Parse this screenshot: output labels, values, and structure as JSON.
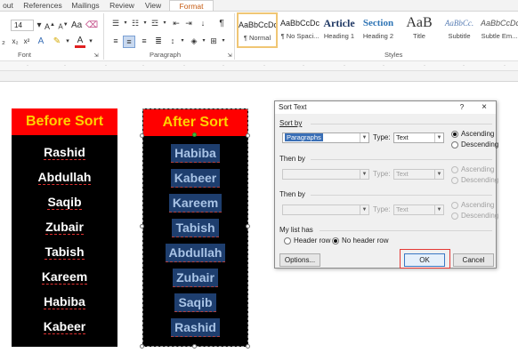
{
  "ribbon": {
    "tabs": [
      "out",
      "References",
      "Mailings",
      "Review",
      "View",
      "Format"
    ],
    "font_size": "14",
    "group_font": "Font",
    "group_paragraph": "Paragraph",
    "group_styles": "Styles",
    "styles": [
      {
        "sample": "AaBbCcDc",
        "name": "¶ Normal"
      },
      {
        "sample": "AaBbCcDc",
        "name": "¶ No Spaci..."
      },
      {
        "sample": "Article",
        "name": "Heading 1"
      },
      {
        "sample": "Section",
        "name": "Heading 2"
      },
      {
        "sample": "AaB",
        "name": "Title"
      },
      {
        "sample": "AaBbCc.",
        "name": "Subtitle"
      },
      {
        "sample": "AaBbCcDc",
        "name": "Subtle Em..."
      }
    ]
  },
  "before": {
    "title": "Before Sort",
    "names": [
      "Rashid",
      "Abdullah",
      "Saqib",
      "Zubair",
      "Tabish",
      "Kareem",
      "Habiba",
      "Kabeer"
    ]
  },
  "after": {
    "title": "After Sort",
    "names": [
      "Habiba",
      "Kabeer",
      "Kareem",
      "Tabish",
      "Abdullah",
      "Zubair",
      "Saqib",
      "Rashid"
    ]
  },
  "dialog": {
    "title": "Sort Text",
    "help": "?",
    "close": "×",
    "sort_by": "Sort by",
    "sort_by_value": "Paragraphs",
    "type_label": "Type:",
    "type_value": "Text",
    "ascending": "Ascending",
    "descending": "Descending",
    "then_by": "Then by",
    "then_by_2": "Then by",
    "list_has": "My list has",
    "header_row": "Header row",
    "no_header_row": "No header row",
    "options": "Options...",
    "ok": "OK",
    "cancel": "Cancel"
  },
  "colors": {
    "header_bg": "#ff0000",
    "header_text": "#ffd200",
    "column_bg": "#000000",
    "selection": "#1e3e6e",
    "ok_highlight": "#e53935"
  }
}
